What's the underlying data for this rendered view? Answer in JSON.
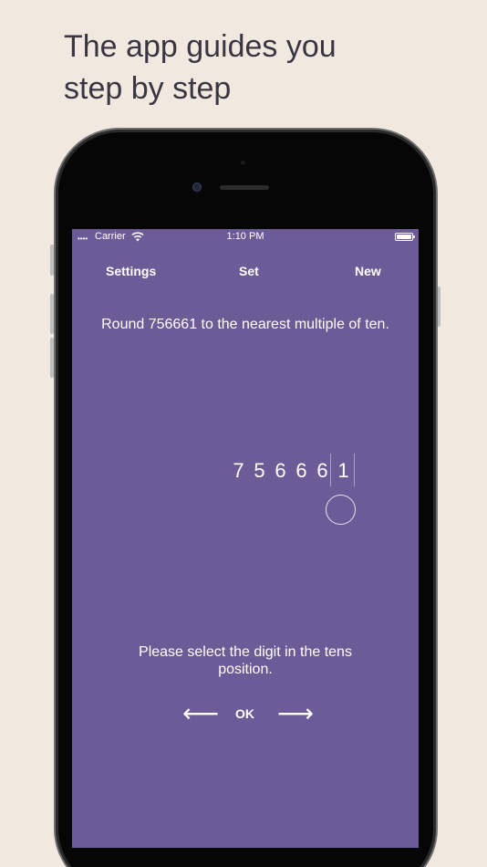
{
  "promo": {
    "headline": "The app guides you\nstep by step"
  },
  "status_bar": {
    "signal": "••••",
    "carrier": "Carrier",
    "time": "1:10 PM"
  },
  "nav": {
    "settings": "Settings",
    "set": "Set",
    "new": "New"
  },
  "question": "Round 756661 to the nearest multiple of ten.",
  "number_digits": [
    "7",
    "5",
    "6",
    "6",
    "6",
    "1"
  ],
  "instruction": "Please select the digit in the tens position.",
  "controls": {
    "prev_arrow": "⟵",
    "ok": "OK",
    "next_arrow": "⟶"
  },
  "colors": {
    "background": "#f1e9e0",
    "screen": "#6c5b96",
    "phone_body": "#060606"
  }
}
